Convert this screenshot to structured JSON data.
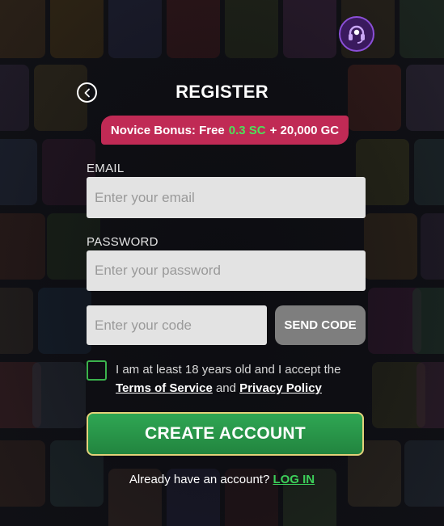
{
  "header": {
    "title": "REGISTER"
  },
  "bonus": {
    "prefix": "Novice Bonus: Free",
    "sc_amount": "0.3 SC",
    "suffix": "+ 20,000 GC"
  },
  "form": {
    "email_label": "EMAIL",
    "email_placeholder": "Enter your email",
    "email_value": "",
    "password_label": "PASSWORD",
    "password_placeholder": "Enter your password",
    "password_value": "",
    "code_placeholder": "Enter your code",
    "code_value": "",
    "send_code_label": "SEND CODE",
    "age_checkbox_checked": false,
    "terms_line1": "I am at least 18 years old and I accept the",
    "terms_link": "Terms of Service",
    "terms_and": "and",
    "privacy_link": "Privacy Policy",
    "create_account_label": "CREATE ACCOUNT"
  },
  "footer": {
    "login_prompt": "Already have an account?",
    "login_link": "LOG IN"
  },
  "icons": {
    "support": "headset-icon",
    "back": "chevron-left-icon"
  },
  "colors": {
    "bonus_bg": "#c02a55",
    "sc_green": "#4ee05a",
    "create_button": "#2fa653",
    "create_border": "#e3d27a",
    "link_green": "#3ccf5a",
    "support_purple": "#8b4fd8"
  }
}
